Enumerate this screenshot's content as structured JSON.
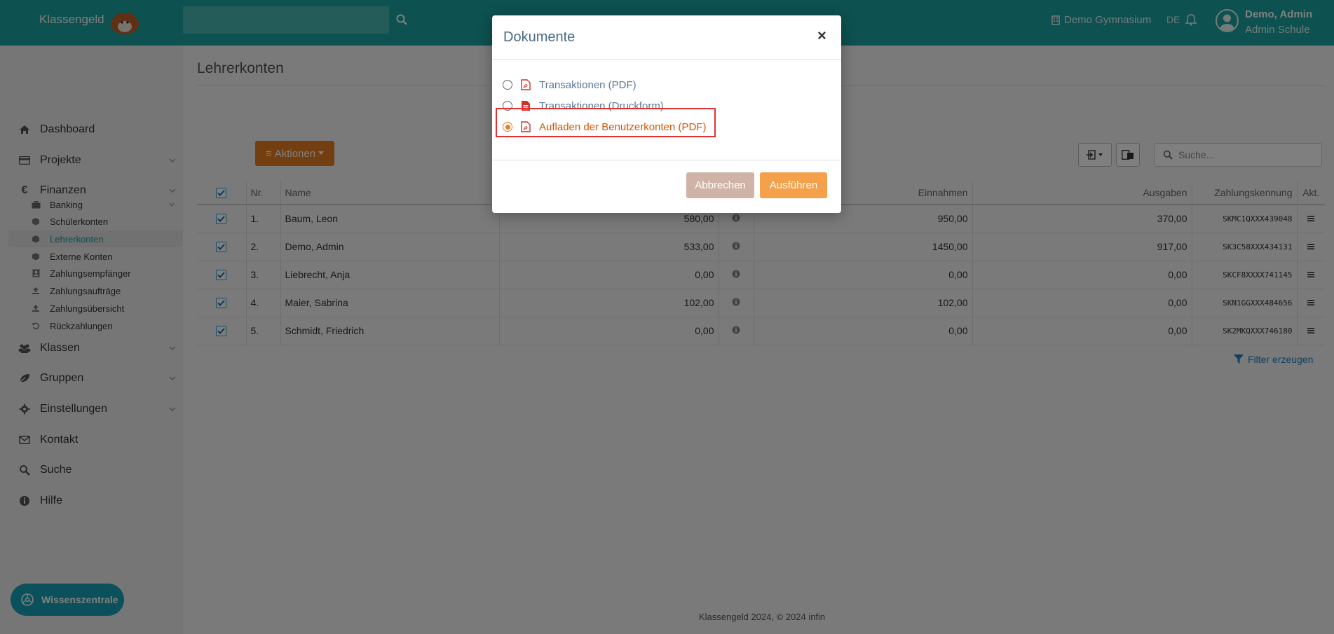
{
  "app": {
    "brand": "Klassengeld"
  },
  "header": {
    "school": "Demo Gymnasium",
    "language": "DE",
    "user_name": "Demo, Admin",
    "user_role": "Admin Schule"
  },
  "sidebar": {
    "items": [
      {
        "label": "Dashboard",
        "icon": "home-icon"
      },
      {
        "label": "Projekte",
        "icon": "card-icon"
      },
      {
        "label": "Finanzen",
        "icon": "euro-icon"
      },
      {
        "label": "Klassen",
        "icon": "users-icon"
      },
      {
        "label": "Gruppen",
        "icon": "leaf-icon"
      },
      {
        "label": "Einstellungen",
        "icon": "gear-icon"
      },
      {
        "label": "Kontakt",
        "icon": "envelope-icon"
      },
      {
        "label": "Suche",
        "icon": "search-icon"
      },
      {
        "label": "Hilfe",
        "icon": "info-icon"
      }
    ],
    "finanzen_sub": [
      {
        "label": "Banking"
      },
      {
        "label": "Schülerkonten"
      },
      {
        "label": "Lehrerkonten"
      },
      {
        "label": "Externe Konten"
      },
      {
        "label": "Zahlungsempfänger"
      },
      {
        "label": "Zahlungsaufträge"
      },
      {
        "label": "Zahlungsübersicht"
      },
      {
        "label": "Rückzahlungen"
      }
    ],
    "wissen": "Wissenszentrale"
  },
  "main": {
    "title": "Lehrerkonten",
    "actions_label": "Aktionen",
    "search_placeholder": "Suche...",
    "filter_link": "Filter erzeugen",
    "footer": "Klassengeld 2024, © 2024 infin"
  },
  "table": {
    "headers": [
      "Nr.",
      "Name",
      "Einnahmen",
      "Ausgaben",
      "Zahlungskennung",
      "Akt."
    ],
    "rows": [
      {
        "nr": "1.",
        "name": "Baum, Leon",
        "balance": "580,00",
        "positive": true,
        "income": "950,00",
        "expense": "370,00",
        "code": "SKMC1QXXX439048"
      },
      {
        "nr": "2.",
        "name": "Demo, Admin",
        "balance": "533,00",
        "positive": true,
        "income": "1450,00",
        "expense": "917,00",
        "code": "SK3C58XXX434131"
      },
      {
        "nr": "3.",
        "name": "Liebrecht, Anja",
        "balance": "0,00",
        "positive": false,
        "income": "0,00",
        "expense": "0,00",
        "code": "SKCF8XXXX741145"
      },
      {
        "nr": "4.",
        "name": "Maier, Sabrina",
        "balance": "102,00",
        "positive": true,
        "income": "102,00",
        "expense": "0,00",
        "code": "SKN1GGXXX484656"
      },
      {
        "nr": "5.",
        "name": "Schmidt, Friedrich",
        "balance": "0,00",
        "positive": false,
        "income": "0,00",
        "expense": "0,00",
        "code": "SK2MKQXXX746180"
      }
    ]
  },
  "modal": {
    "title": "Dokumente",
    "close": "×",
    "options": [
      {
        "label": "Transaktionen (PDF)",
        "selected": false
      },
      {
        "label": "Transaktionen (Druckform)",
        "selected": false
      },
      {
        "label": "Aufladen der Benutzerkonten (PDF)",
        "selected": true
      }
    ],
    "cancel": "Abbrechen",
    "run": "Ausführen"
  },
  "colors": {
    "teal": "#1aa3a1",
    "orange": "#e67e22",
    "green": "#2e8b2e",
    "highlight": "#e53030"
  }
}
